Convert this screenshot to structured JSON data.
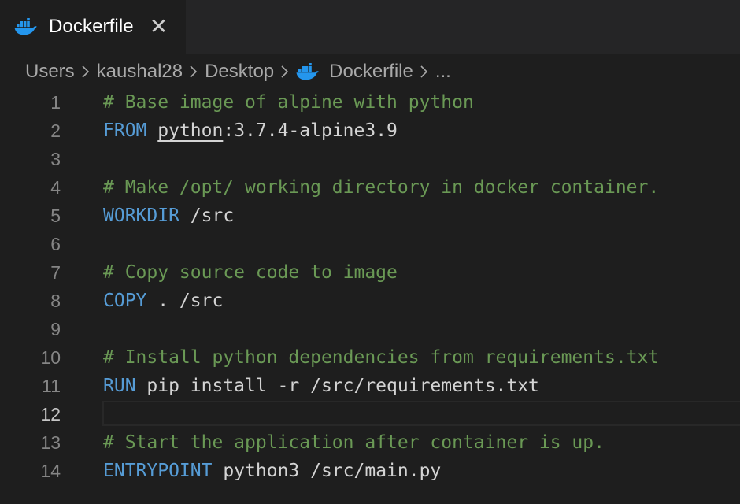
{
  "tab": {
    "label": "Dockerfile",
    "close_glyph": "✕",
    "icon": "docker-whale-icon"
  },
  "breadcrumb": {
    "items": [
      "Users",
      "kaushal28",
      "Desktop",
      "Dockerfile",
      "..."
    ]
  },
  "editor": {
    "active_line": "12",
    "lines": [
      {
        "n": "1",
        "parts": [
          {
            "t": "# Base image of alpine with python",
            "k": "comment"
          }
        ]
      },
      {
        "n": "2",
        "parts": [
          {
            "t": "FROM",
            "k": "keyword"
          },
          {
            "t": " ",
            "k": "plain"
          },
          {
            "t": "python",
            "k": "plain-underline"
          },
          {
            "t": ":3.7.4-alpine3.9",
            "k": "plain"
          }
        ]
      },
      {
        "n": "3",
        "parts": []
      },
      {
        "n": "4",
        "parts": [
          {
            "t": "# Make /opt/ working directory in docker container.",
            "k": "comment"
          }
        ]
      },
      {
        "n": "5",
        "parts": [
          {
            "t": "WORKDIR",
            "k": "keyword"
          },
          {
            "t": " /src",
            "k": "plain"
          }
        ]
      },
      {
        "n": "6",
        "parts": []
      },
      {
        "n": "7",
        "parts": [
          {
            "t": "# Copy source code to image",
            "k": "comment"
          }
        ]
      },
      {
        "n": "8",
        "parts": [
          {
            "t": "COPY",
            "k": "keyword"
          },
          {
            "t": " . /src",
            "k": "plain"
          }
        ]
      },
      {
        "n": "9",
        "parts": []
      },
      {
        "n": "10",
        "parts": [
          {
            "t": "# Install python dependencies from requirements.txt",
            "k": "comment"
          }
        ]
      },
      {
        "n": "11",
        "parts": [
          {
            "t": "RUN",
            "k": "keyword"
          },
          {
            "t": " pip install -r /src/requirements.txt",
            "k": "plain"
          }
        ]
      },
      {
        "n": "12",
        "parts": []
      },
      {
        "n": "13",
        "parts": [
          {
            "t": "# Start the application after container is up.",
            "k": "comment"
          }
        ]
      },
      {
        "n": "14",
        "parts": [
          {
            "t": "ENTRYPOINT",
            "k": "keyword"
          },
          {
            "t": " python3 /src/main.py",
            "k": "plain"
          }
        ]
      }
    ]
  },
  "colors": {
    "background": "#1e1e1e",
    "tabbar": "#252526",
    "comment": "#6a9955",
    "keyword": "#569cd6",
    "text": "#d4d4d4",
    "line_number": "#858585",
    "docker_blue": "#2496ed"
  }
}
